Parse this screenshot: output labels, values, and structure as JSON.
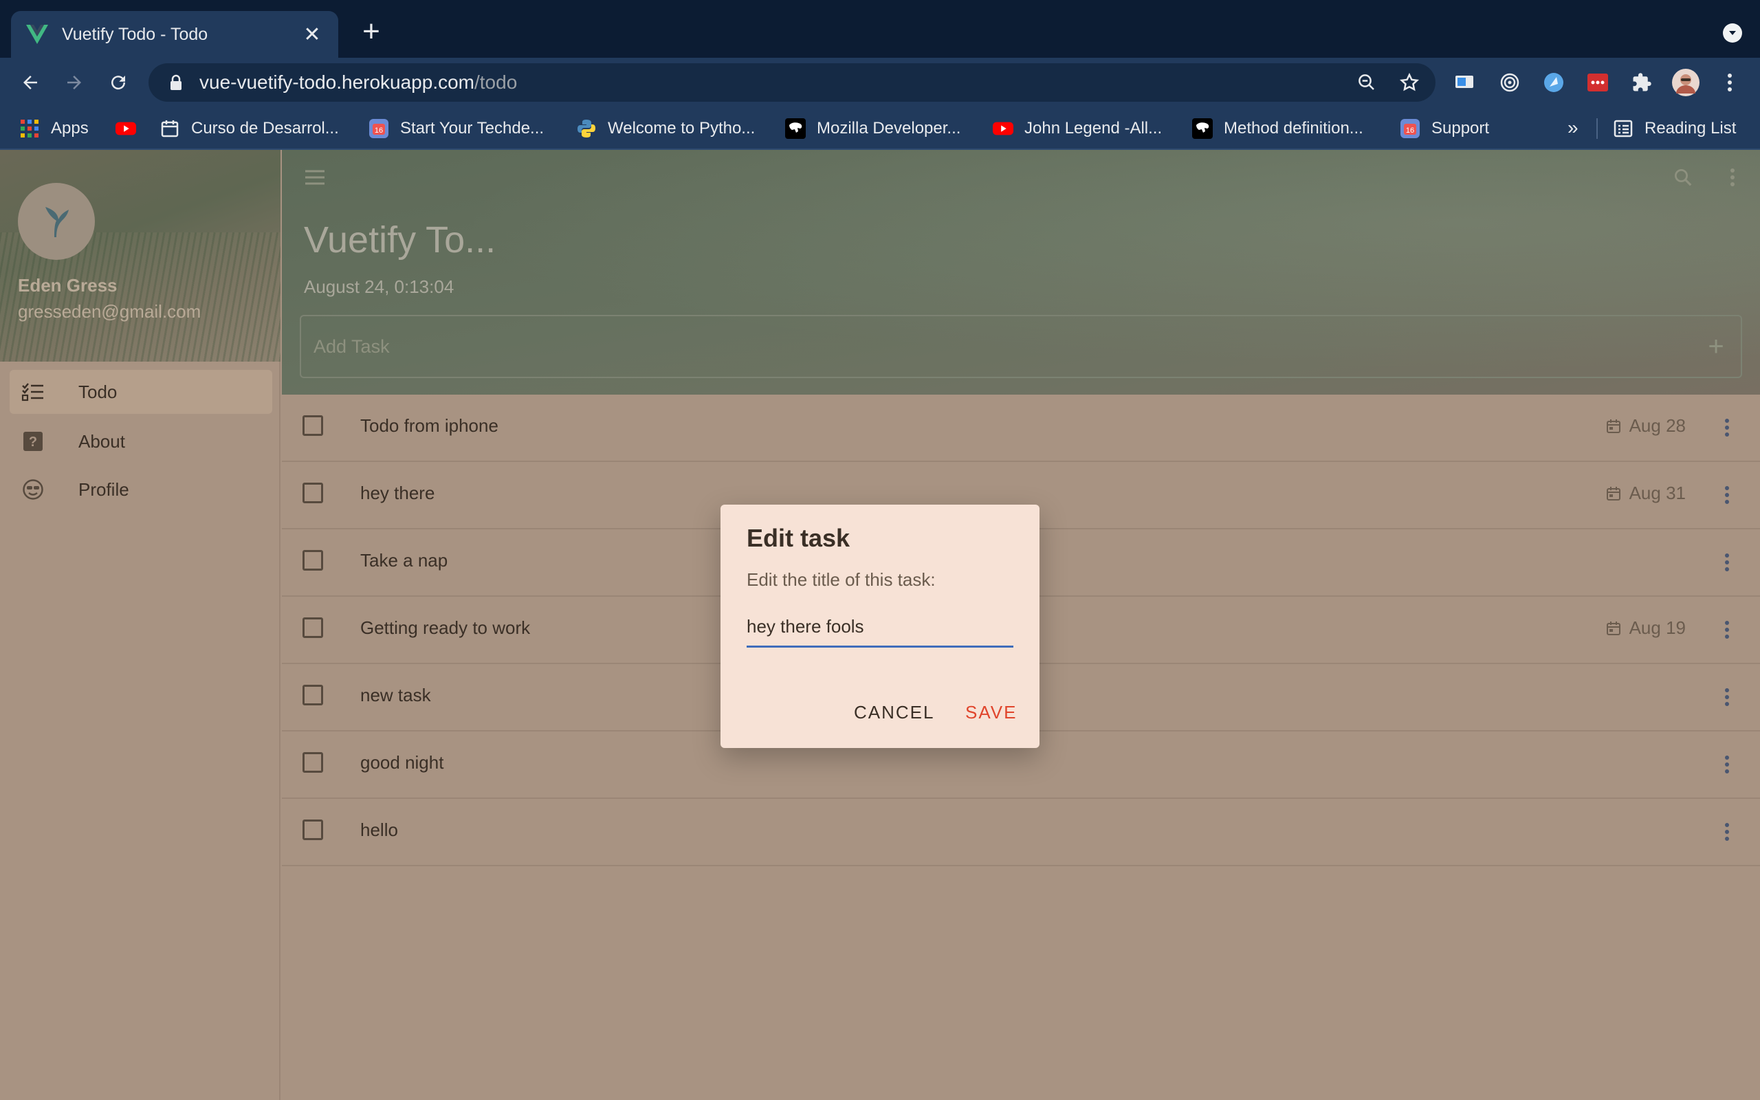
{
  "browser": {
    "tab_title": "Vuetify Todo - Todo",
    "url_host": "vue-vuetify-todo.herokuapp.com",
    "url_path": "/todo",
    "bookmarks": [
      {
        "label": "Apps",
        "icon": "apps-grid-icon"
      },
      {
        "label": "",
        "icon": "youtube-icon"
      },
      {
        "label": "Curso de Desarrol...",
        "icon": "calendar-bookmark-icon"
      },
      {
        "label": "Start Your Techde...",
        "icon": "hashnode-icon"
      },
      {
        "label": "Welcome to Pytho...",
        "icon": "python-icon"
      },
      {
        "label": "Mozilla Developer...",
        "icon": "mdn-icon"
      },
      {
        "label": "John Legend -All...",
        "icon": "youtube-icon"
      },
      {
        "label": "Method definition...",
        "icon": "mdn-icon"
      },
      {
        "label": "Support",
        "icon": "hashnode-icon"
      }
    ],
    "more_bookmarks": "»",
    "reading_list": "Reading List"
  },
  "drawer": {
    "user_name": "Eden Gress",
    "user_email": "gresseden@gmail.com",
    "nav": [
      {
        "label": "Todo",
        "icon": "format-list-checks-icon",
        "active": true
      },
      {
        "label": "About",
        "icon": "help-box-icon",
        "active": false
      },
      {
        "label": "Profile",
        "icon": "sunglasses-face-icon",
        "active": false
      }
    ]
  },
  "header": {
    "title": "Vuetify To...",
    "date": "August 24, 0:13:04",
    "add_task_placeholder": "Add Task"
  },
  "tasks": [
    {
      "title": "Todo from iphone",
      "due": "Aug 28"
    },
    {
      "title": "hey there",
      "due": "Aug 31"
    },
    {
      "title": "Take a nap",
      "due": ""
    },
    {
      "title": "Getting ready to work",
      "due": "Aug 19"
    },
    {
      "title": "new task",
      "due": ""
    },
    {
      "title": "good night",
      "due": ""
    },
    {
      "title": "hello",
      "due": ""
    }
  ],
  "dialog": {
    "title": "Edit task",
    "subtitle": "Edit the title of this task:",
    "input_value": "hey there fools",
    "cancel_label": "CANCEL",
    "save_label": "SAVE"
  },
  "colors": {
    "accent": "#e0452c",
    "input_underline": "#3f6dbb",
    "browser_frame": "#0c1c33"
  }
}
